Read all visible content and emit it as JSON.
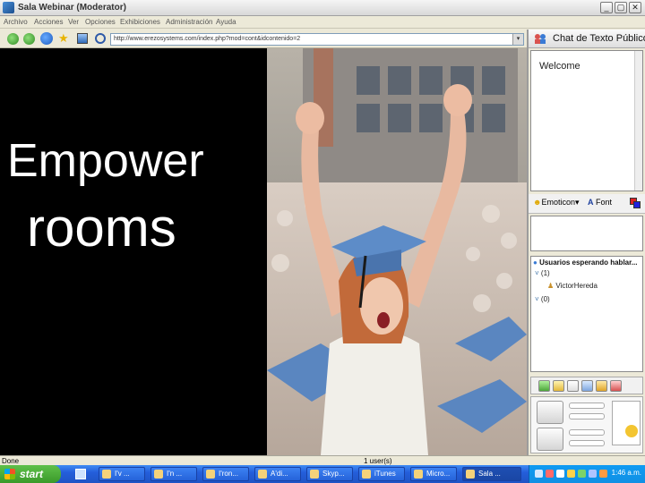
{
  "window": {
    "title": "Sala Webinar (Moderator)",
    "controls": [
      "_",
      "▢",
      "✕"
    ]
  },
  "menu": [
    "Archivo",
    "Acciones",
    "Ver",
    "Opciones",
    "Exhibiciones",
    "Administración",
    "Ayuda"
  ],
  "nav": {
    "back_icon": "back-arrow-icon",
    "forward_icon": "forward-arrow-icon",
    "favorite_icon": "star-icon",
    "url": "http://www.erezosystems.com/index.php?mod=cont&idcontenido=2"
  },
  "slide": {
    "line1": "Empower",
    "line2": "rooms"
  },
  "chat": {
    "title": "Chat de Texto Público",
    "welcome": "Welcome",
    "emoticon_label": "Emoticon",
    "font_label": "Font"
  },
  "waiting": {
    "title": "Usuarios esperando hablar...",
    "group1_count": "(1)",
    "user1": "VictorHereda",
    "group2_count": "(0)"
  },
  "status": {
    "left": "Done",
    "users": "1 user(s)"
  },
  "taskbar": {
    "start": "start",
    "tasks": [
      "I'v ...",
      "I'n ...",
      "I'ron...",
      "A'di...",
      "Skyp...",
      "iTunes",
      "Micro...",
      "Sala ..."
    ],
    "clock": "1:46 a.m."
  },
  "colors": {
    "chrome": "#ece9d8",
    "taskbar": "#245edb",
    "start": "#3a9a2a",
    "slide_background": "#000000",
    "slide_text": "#ffffff"
  }
}
